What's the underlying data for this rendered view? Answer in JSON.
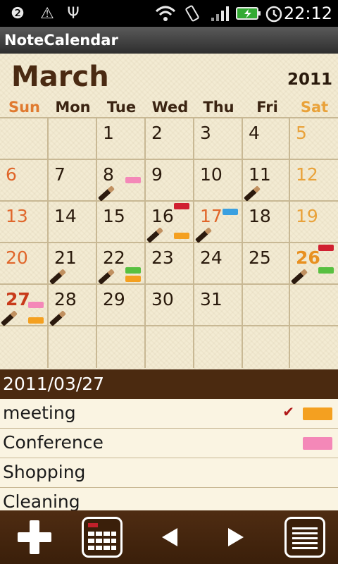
{
  "status_bar": {
    "time": "22:12",
    "icons": [
      "notification-2-icon",
      "warning-icon",
      "usb-icon",
      "wifi-icon",
      "vibrate-icon",
      "signal-icon",
      "battery-charging-icon",
      "alarm-icon"
    ]
  },
  "app": {
    "title": "NoteCalendar"
  },
  "calendar": {
    "month": "March",
    "year": "2011",
    "weekdays": [
      "Sun",
      "Mon",
      "Tue",
      "Wed",
      "Thu",
      "Fri",
      "Sat"
    ],
    "days": {
      "d1": "1",
      "d2": "2",
      "d3": "3",
      "d4": "4",
      "d5": "5",
      "d6": "6",
      "d7": "7",
      "d8": "8",
      "d9": "9",
      "d10": "10",
      "d11": "11",
      "d12": "12",
      "d13": "13",
      "d14": "14",
      "d15": "15",
      "d16": "16",
      "d17": "17",
      "d18": "18",
      "d19": "19",
      "d20": "20",
      "d21": "21",
      "d22": "22",
      "d23": "23",
      "d24": "24",
      "d25": "25",
      "d26": "26",
      "d27": "27",
      "d28": "28",
      "d29": "29",
      "d30": "30",
      "d31": "31"
    },
    "colors": {
      "sunday": "#e0662a",
      "saturday": "#e9a23a",
      "today": "#c83a1a"
    }
  },
  "selected_date": "2011/03/27",
  "notes": [
    {
      "label": "meeting",
      "checked": true,
      "tag_color": "#f4a020"
    },
    {
      "label": "Conference",
      "checked": false,
      "tag_color": "#f488b8"
    },
    {
      "label": "Shopping",
      "checked": false,
      "tag_color": ""
    },
    {
      "label": "Cleaning",
      "checked": false,
      "tag_color": ""
    }
  ],
  "toolbar": {
    "buttons": [
      "add-note-button",
      "calendar-view-button",
      "previous-month-button",
      "next-month-button",
      "note-list-button"
    ]
  },
  "tag_colors": {
    "pink": "#f488b8",
    "red": "#d02030",
    "blue": "#3aa0e0",
    "orange": "#f4a020",
    "green": "#58c040"
  }
}
